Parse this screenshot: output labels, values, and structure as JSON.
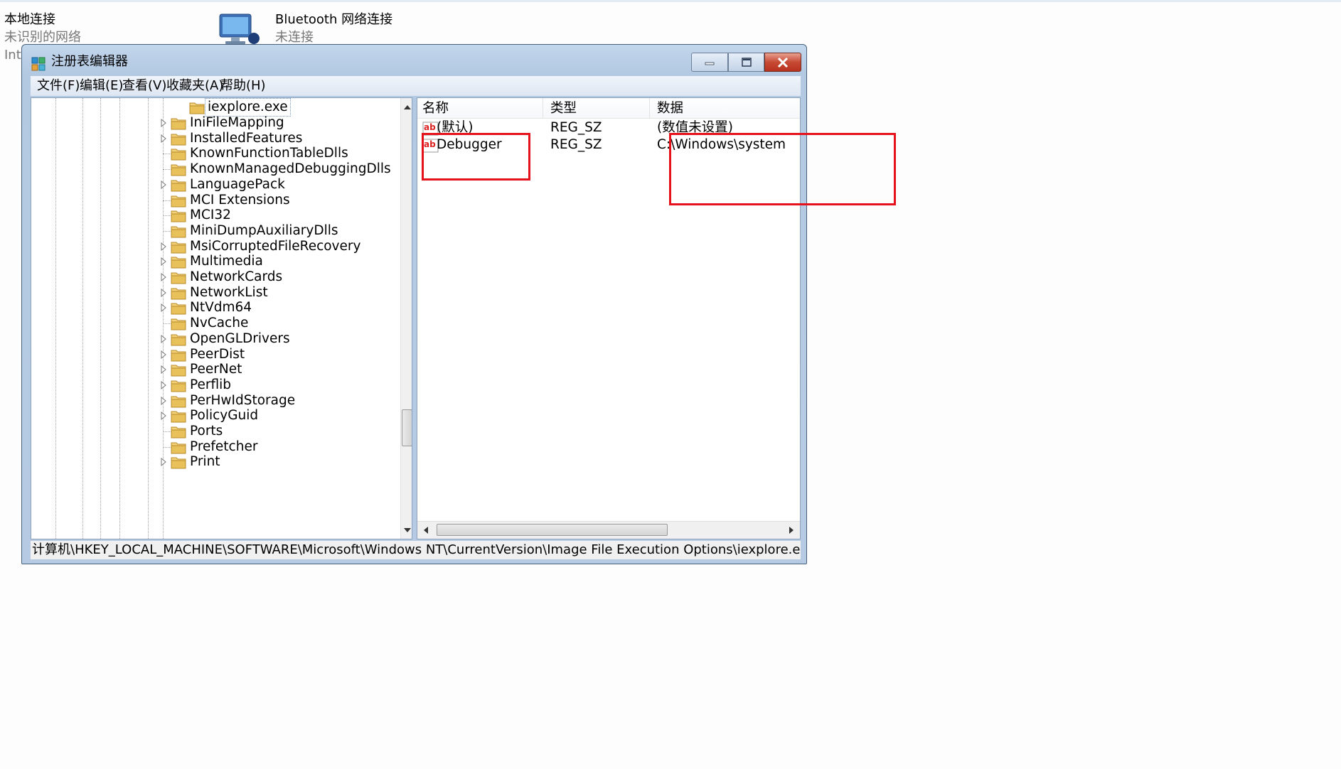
{
  "network": {
    "local": {
      "name": "本地连接",
      "status": "未识别的网络",
      "extra": "Int"
    },
    "bluetooth": {
      "name": "Bluetooth 网络连接",
      "status": "未连接"
    }
  },
  "window": {
    "title": "注册表编辑器",
    "menus": [
      "文件(F)",
      "编辑(E)",
      "查看(V)",
      "收藏夹(A)",
      "帮助(H)"
    ]
  },
  "tree": {
    "selected": "iexplore.exe",
    "items": [
      "IniFileMapping",
      "InstalledFeatures",
      "KnownFunctionTableDlls",
      "KnownManagedDebuggingDlls",
      "LanguagePack",
      "MCI Extensions",
      "MCI32",
      "MiniDumpAuxiliaryDlls",
      "MsiCorruptedFileRecovery",
      "Multimedia",
      "NetworkCards",
      "NetworkList",
      "NtVdm64",
      "NvCache",
      "OpenGLDrivers",
      "PeerDist",
      "PeerNet",
      "Perflib",
      "PerHwIdStorage",
      "PolicyGuid",
      "Ports",
      "Prefetcher",
      "Print"
    ]
  },
  "list": {
    "headers": {
      "name": "名称",
      "type": "类型",
      "data": "数据"
    },
    "rows": [
      {
        "name": "(默认)",
        "type": "REG_SZ",
        "data": "(数值未设置)"
      },
      {
        "name": "Debugger",
        "type": "REG_SZ",
        "data": "C:\\Windows\\system"
      }
    ]
  },
  "statusbar": {
    "path": "计算机\\HKEY_LOCAL_MACHINE\\SOFTWARE\\Microsoft\\Windows NT\\CurrentVersion\\Image File Execution Options\\iexplore.e"
  },
  "colors": {
    "highlight": "#e5121c",
    "titlebar": "#b6cbe3",
    "folder": "#e8c15a"
  }
}
